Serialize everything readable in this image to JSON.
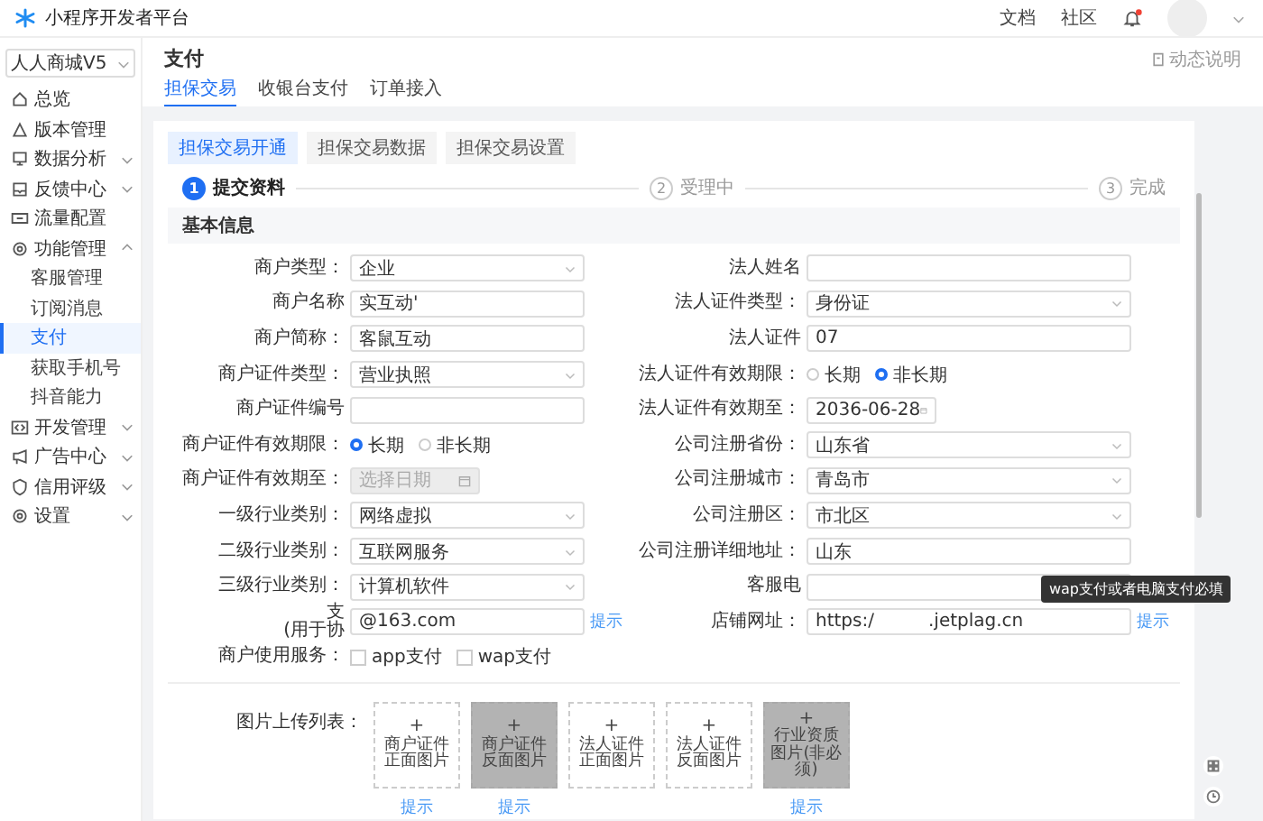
{
  "header": {
    "title": "小程序开发者平台",
    "links": [
      "文档",
      "社区"
    ],
    "notification": true
  },
  "sidebar": {
    "app": "人人商城V5",
    "items": [
      {
        "label": "总览",
        "selected": false
      },
      {
        "label": "版本管理",
        "selected": false
      },
      {
        "label": "数据分析",
        "expanded": false,
        "selected": false
      },
      {
        "label": "反馈中心",
        "expanded": false,
        "selected": false
      },
      {
        "label": "流量配置",
        "selected": false
      },
      {
        "label": "功能管理",
        "expanded": true,
        "selected": false,
        "children": [
          {
            "label": "客服管理",
            "selected": false
          },
          {
            "label": "订阅消息",
            "selected": false
          },
          {
            "label": "支付",
            "selected": true
          },
          {
            "label": "获取手机号",
            "selected": false
          },
          {
            "label": "抖音能力",
            "selected": false
          }
        ]
      },
      {
        "label": "开发管理",
        "expanded": false,
        "selected": false
      },
      {
        "label": "广告中心",
        "expanded": false,
        "selected": false
      },
      {
        "label": "信用评级",
        "expanded": false,
        "selected": false
      },
      {
        "label": "设置",
        "expanded": false,
        "selected": false
      }
    ]
  },
  "page": {
    "title": "支付",
    "help": "动态说明",
    "tabs": [
      {
        "label": "担保交易",
        "selected": true
      },
      {
        "label": "收银台支付",
        "selected": false
      },
      {
        "label": "订单接入",
        "selected": false
      }
    ]
  },
  "subtabs": [
    {
      "label": "担保交易开通",
      "selected": true
    },
    {
      "label": "担保交易数据",
      "selected": false
    },
    {
      "label": "担保交易设置",
      "selected": false
    }
  ],
  "steps": [
    {
      "number": "1",
      "label": "提交资料",
      "active": true
    },
    {
      "number": "2",
      "label": "受理中",
      "active": false
    },
    {
      "number": "3",
      "label": "完成",
      "active": false
    }
  ],
  "section_title": "基本信息",
  "form": {
    "left": [
      {
        "label": "商户类型：",
        "kind": "select",
        "value": "企业"
      },
      {
        "label": "商户名称",
        "kind": "input",
        "value": "实互动'"
      },
      {
        "label": "商户简称：",
        "kind": "input",
        "value": "客鼠互动"
      },
      {
        "label": "商户证件类型：",
        "kind": "select",
        "value": "营业执照"
      },
      {
        "label": "商户证件编号",
        "kind": "input"
      },
      {
        "label": "商户证件有效期限：",
        "kind": "radio",
        "options": [
          {
            "label": "长期",
            "selected": true
          },
          {
            "label": "非长期",
            "selected": false
          }
        ]
      },
      {
        "label": "商户证件有效期至：",
        "kind": "date",
        "placeholder": "选择日期",
        "disabled": true
      },
      {
        "label": "一级行业类别：",
        "kind": "select",
        "value": "网络虚拟"
      },
      {
        "label": "二级行业类别：",
        "kind": "select",
        "value": "互联网服务"
      },
      {
        "label": "三级行业类别：",
        "kind": "select",
        "value": "计算机软件"
      },
      {
        "label": "支",
        "label_note": "(用于协",
        "kind": "input",
        "value": "@163.com",
        "link": "提示"
      },
      {
        "label": "商户使用服务：",
        "kind": "checkbox",
        "options": [
          {
            "label": "app支付",
            "checked": false
          },
          {
            "label": "wap支付",
            "checked": false
          }
        ]
      }
    ],
    "right": [
      {
        "label": "法人姓名",
        "kind": "input"
      },
      {
        "label": "法人证件类型：",
        "kind": "select",
        "value": "身份证"
      },
      {
        "label": "法人证件",
        "kind": "input",
        "value": "07"
      },
      {
        "label": "法人证件有效期限：",
        "kind": "radio",
        "options": [
          {
            "label": "长期",
            "selected": false
          },
          {
            "label": "非长期",
            "selected": true
          }
        ]
      },
      {
        "label": "法人证件有效期至：",
        "kind": "date",
        "value": "2036-06-28",
        "disabled": false
      },
      {
        "label": "公司注册省份：",
        "kind": "select",
        "value": "山东省"
      },
      {
        "label": "公司注册城市：",
        "kind": "select",
        "value": "青岛市"
      },
      {
        "label": "公司注册区：",
        "kind": "select",
        "value": "市北区"
      },
      {
        "label": "公司注册详细地址：",
        "kind": "input",
        "value": "山东"
      },
      {
        "label": "客服电",
        "kind": "input"
      },
      {
        "label": "店铺网址：",
        "kind": "input",
        "value": "https:/",
        "value_end": ".jetplag.cn",
        "link": "提示"
      }
    ]
  },
  "tooltip": "wap支付或者电脑支付必填",
  "uploads": {
    "label": "图片上传列表：",
    "items": [
      {
        "text": "商户证件正面图片",
        "filled": false,
        "link": "提示"
      },
      {
        "text": "商户证件反面图片",
        "filled": true,
        "link": "提示"
      },
      {
        "text": "法人证件正面图片",
        "filled": false
      },
      {
        "text": "法人证件反面图片",
        "filled": false
      },
      {
        "text": "行业资质图片(非必须)",
        "filled": true,
        "link": "提示"
      }
    ],
    "plus": "+"
  }
}
